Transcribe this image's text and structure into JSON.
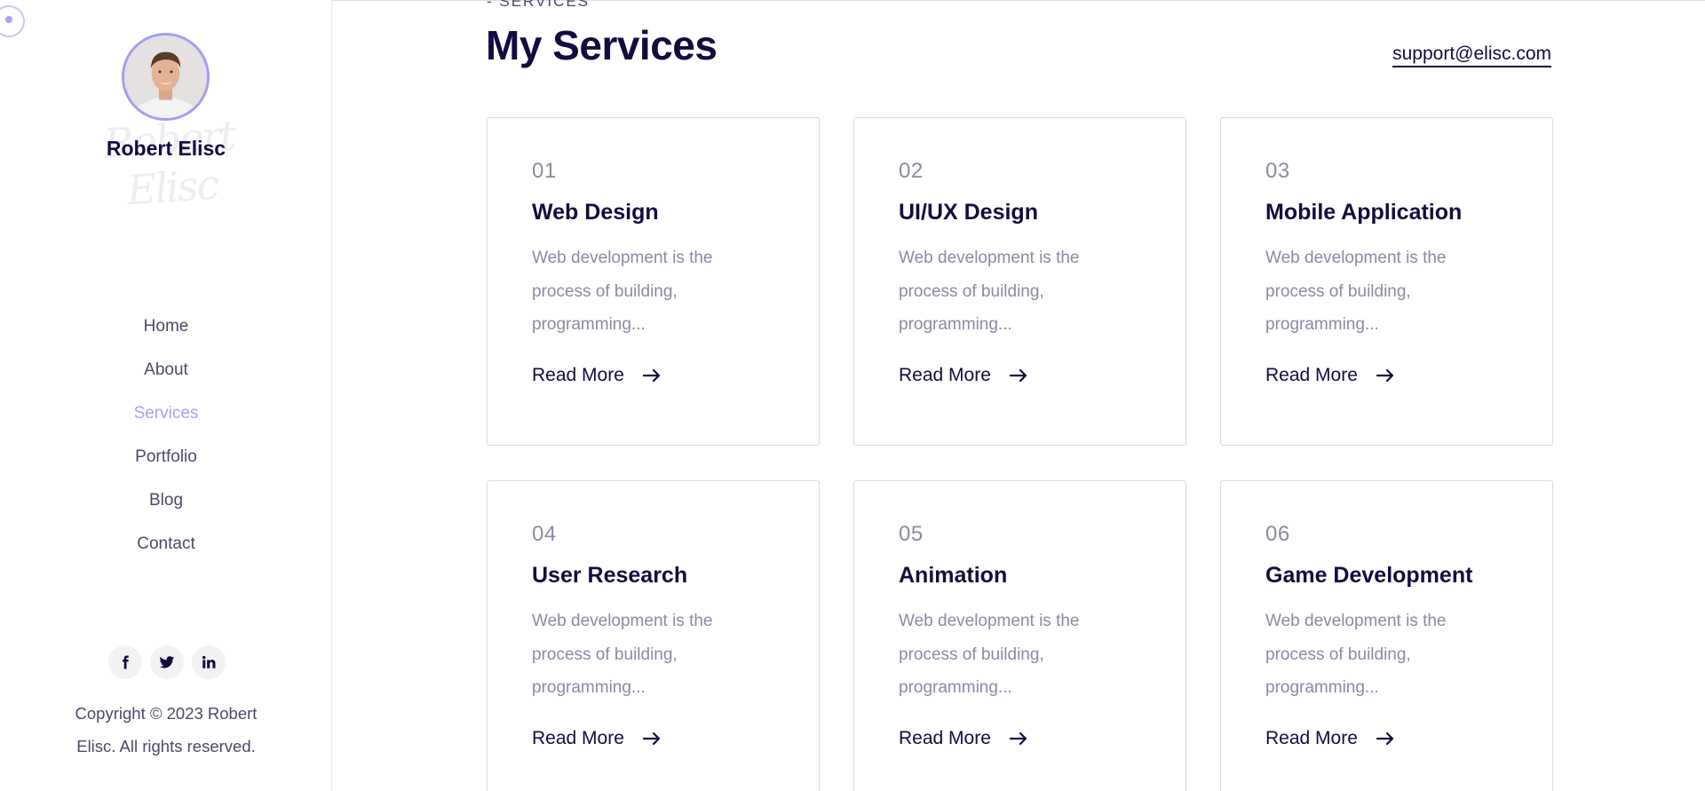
{
  "profile": {
    "name": "Robert Elisc",
    "signature": "Robert Elisc"
  },
  "nav": {
    "items": [
      {
        "label": "Home"
      },
      {
        "label": "About"
      },
      {
        "label": "Services",
        "active": true
      },
      {
        "label": "Portfolio"
      },
      {
        "label": "Blog"
      },
      {
        "label": "Contact"
      }
    ]
  },
  "socials": [
    {
      "icon": "facebook-icon"
    },
    {
      "icon": "twitter-icon"
    },
    {
      "icon": "linkedin-icon"
    }
  ],
  "footer": {
    "copyright_line1": "Copyright © 2023 Robert",
    "copyright_line2": "Elisc. All rights reserved."
  },
  "section": {
    "eyebrow": "- SERVICES",
    "title": "My Services",
    "support_email": "support@elisc.com"
  },
  "services": [
    {
      "number": "01",
      "title": "Web Design",
      "description": "Web development is the process of building, programming...",
      "link_label": "Read More"
    },
    {
      "number": "02",
      "title": "UI/UX Design",
      "description": "Web development is the process of building, programming...",
      "link_label": "Read More"
    },
    {
      "number": "03",
      "title": "Mobile Application",
      "description": "Web development is the process of building, programming...",
      "link_label": "Read More"
    },
    {
      "number": "04",
      "title": "User Research",
      "description": "Web development is the process of building, programming...",
      "link_label": "Read More"
    },
    {
      "number": "05",
      "title": "Animation",
      "description": "Web development is the process of building, programming...",
      "link_label": "Read More"
    },
    {
      "number": "06",
      "title": "Game Development",
      "description": "Web development is the process of building, programming...",
      "link_label": "Read More"
    }
  ],
  "colors": {
    "accent": "#a8a1f1",
    "heading": "#140c40",
    "muted": "#8a8aa3"
  }
}
